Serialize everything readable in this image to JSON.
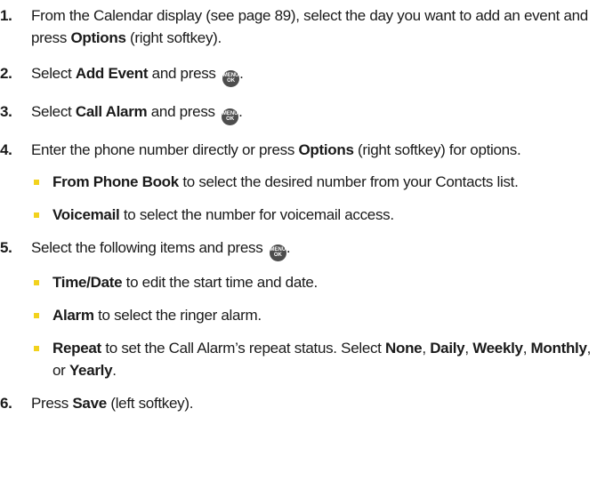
{
  "steps": [
    {
      "num": "1.",
      "parts": [
        {
          "t": "From the Calendar display (see page 89), select the day you want to add an event and press "
        },
        {
          "t": "Options",
          "b": true
        },
        {
          "t": " (right softkey)."
        }
      ]
    },
    {
      "num": "2.",
      "parts": [
        {
          "t": "Select "
        },
        {
          "t": "Add Event",
          "b": true
        },
        {
          "t": " and press "
        },
        {
          "key": true
        },
        {
          "t": "."
        }
      ]
    },
    {
      "num": "3.",
      "parts": [
        {
          "t": "Select "
        },
        {
          "t": "Call Alarm",
          "b": true
        },
        {
          "t": " and press "
        },
        {
          "key": true
        },
        {
          "t": "."
        }
      ]
    },
    {
      "num": "4.",
      "parts": [
        {
          "t": "Enter the phone number directly or press "
        },
        {
          "t": "Options",
          "b": true
        },
        {
          "t": " (right softkey) for options."
        }
      ],
      "subitems": [
        [
          {
            "t": "From Phone Book",
            "b": true
          },
          {
            "t": " to select the desired number from your Contacts list."
          }
        ],
        [
          {
            "t": "Voicemail",
            "b": true
          },
          {
            "t": " to select the number for voicemail access."
          }
        ]
      ]
    },
    {
      "num": "5.",
      "parts": [
        {
          "t": "Select the following items and press "
        },
        {
          "key": true
        },
        {
          "t": "."
        }
      ],
      "subitems": [
        [
          {
            "t": "Time/Date",
            "b": true
          },
          {
            "t": " to edit the start time and date."
          }
        ],
        [
          {
            "t": "Alarm",
            "b": true
          },
          {
            "t": " to select the ringer alarm."
          }
        ],
        [
          {
            "t": "Repeat",
            "b": true
          },
          {
            "t": " to set the Call Alarm’s repeat status. Select "
          },
          {
            "t": "None",
            "b": true
          },
          {
            "t": ", "
          },
          {
            "t": "Daily",
            "b": true
          },
          {
            "t": ", "
          },
          {
            "t": "Weekly",
            "b": true
          },
          {
            "t": ", "
          },
          {
            "t": "Monthly",
            "b": true
          },
          {
            "t": ", or "
          },
          {
            "t": "Yearly",
            "b": true
          },
          {
            "t": "."
          }
        ]
      ]
    },
    {
      "num": "6.",
      "parts": [
        {
          "t": "Press "
        },
        {
          "t": "Save",
          "b": true
        },
        {
          "t": " (left softkey)."
        }
      ]
    }
  ],
  "menu_key": {
    "icon": "menu-ok-key-icon",
    "line1": "MENU",
    "line2": "OK",
    "color": "#4d4d4d"
  },
  "bullet_color": "#f2d21d"
}
